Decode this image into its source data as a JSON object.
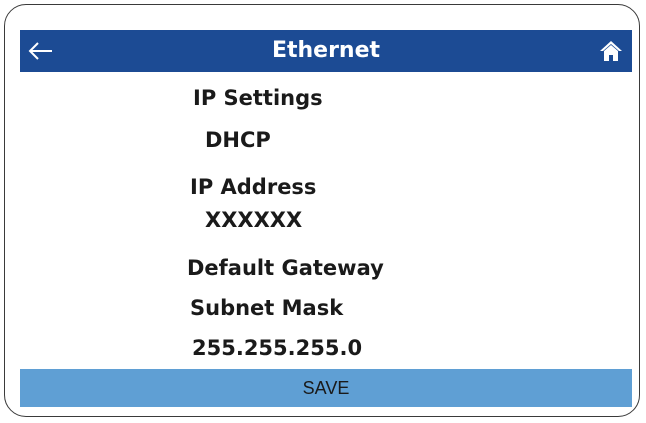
{
  "header": {
    "title": "Ethernet",
    "back_icon": "left-arrow-icon",
    "home_icon": "home-icon"
  },
  "fields": {
    "ip_settings_label": "IP Settings",
    "ip_settings_value": "DHCP",
    "ip_address_label": "IP Address",
    "ip_address_value": "XXXXXX",
    "default_gateway_label": "Default Gateway",
    "subnet_mask_label": "Subnet Mask",
    "subnet_mask_value": "255.255.255.0"
  },
  "actions": {
    "save_label": "SAVE"
  },
  "colors": {
    "header_bg": "#1c4b94",
    "save_bg": "#5f9fd4"
  }
}
